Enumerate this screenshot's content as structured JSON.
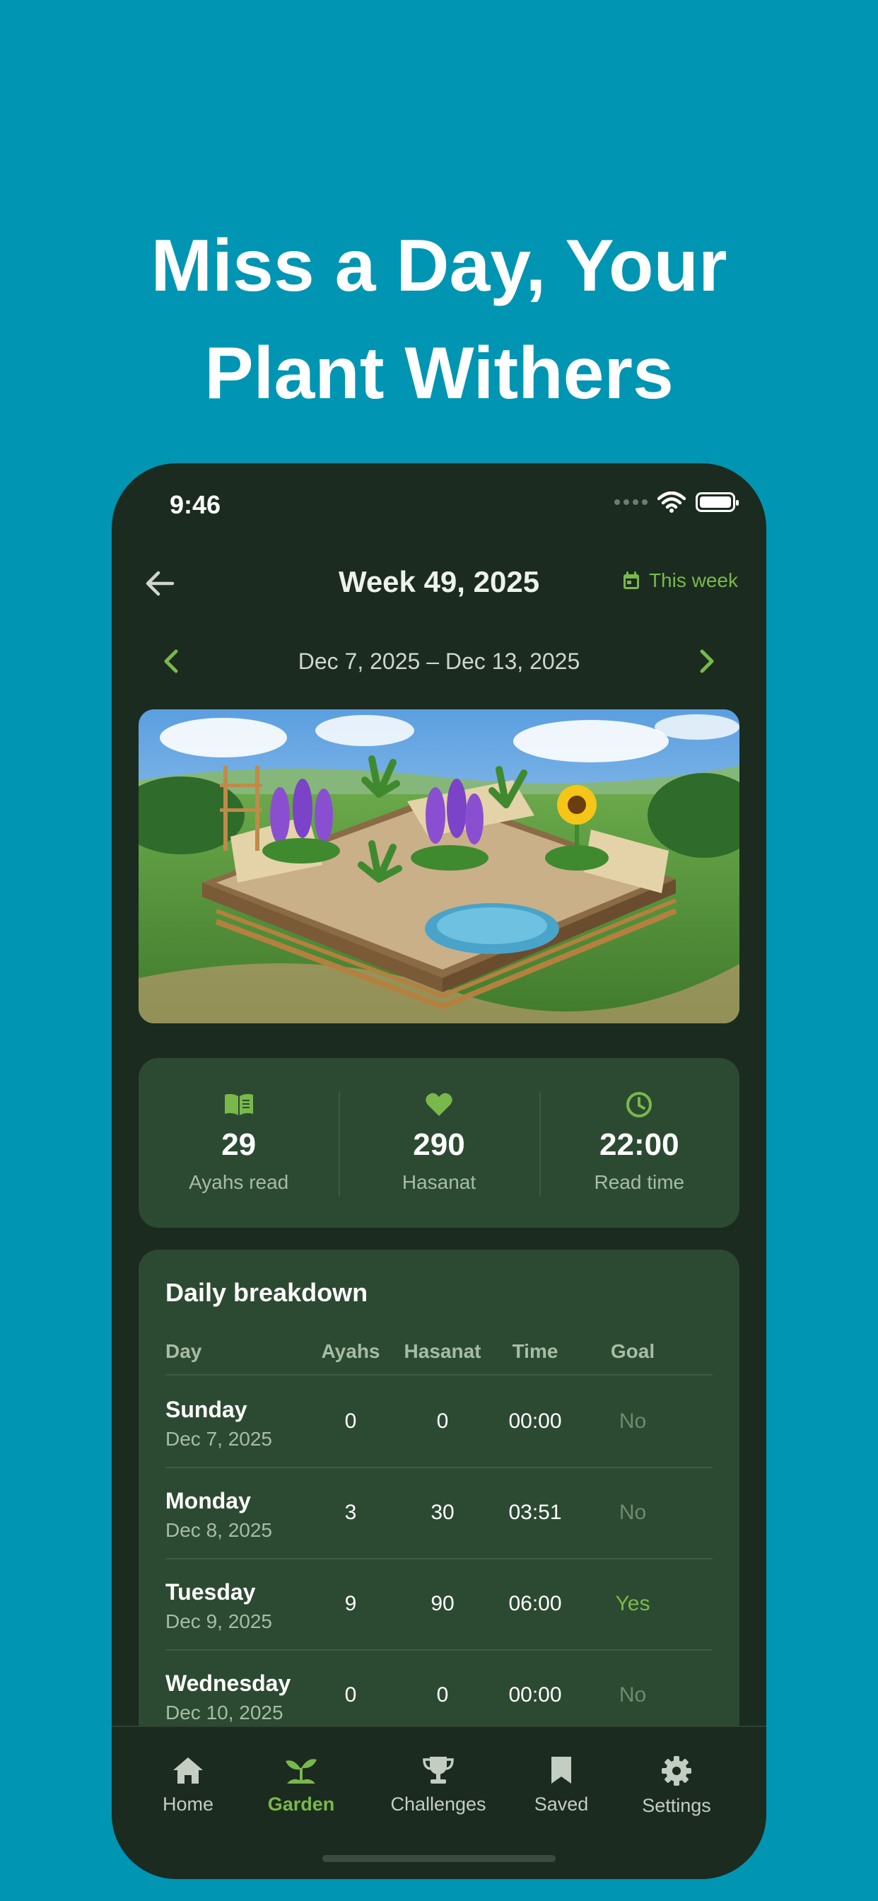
{
  "headline": {
    "line1": "Miss a Day, Your",
    "line2": "Plant Withers"
  },
  "status_bar": {
    "time": "9:46"
  },
  "header": {
    "title": "Week 49, 2025",
    "this_week_label": "This week"
  },
  "date_nav": {
    "range": "Dec 7, 2025 – Dec 13, 2025"
  },
  "garden_image": {
    "alt": "garden-illustration"
  },
  "stats": [
    {
      "icon": "book-icon",
      "value": "29",
      "label": "Ayahs read"
    },
    {
      "icon": "heart-icon",
      "value": "290",
      "label": "Hasanat"
    },
    {
      "icon": "clock-icon",
      "value": "22:00",
      "label": "Read time"
    }
  ],
  "breakdown": {
    "title": "Daily breakdown",
    "columns": {
      "day": "Day",
      "ayahs": "Ayahs",
      "hasanat": "Hasanat",
      "time": "Time",
      "goal": "Goal"
    },
    "rows": [
      {
        "day": "Sunday",
        "date": "Dec 7, 2025",
        "ayahs": "0",
        "hasanat": "0",
        "time": "00:00",
        "goal": "No"
      },
      {
        "day": "Monday",
        "date": "Dec 8, 2025",
        "ayahs": "3",
        "hasanat": "30",
        "time": "03:51",
        "goal": "No"
      },
      {
        "day": "Tuesday",
        "date": "Dec 9, 2025",
        "ayahs": "9",
        "hasanat": "90",
        "time": "06:00",
        "goal": "Yes"
      },
      {
        "day": "Wednesday",
        "date": "Dec 10, 2025",
        "ayahs": "0",
        "hasanat": "0",
        "time": "00:00",
        "goal": "No"
      }
    ]
  },
  "tabbar": [
    {
      "label": "Home",
      "icon": "home-icon",
      "active": false
    },
    {
      "label": "Garden",
      "icon": "sprout-icon",
      "active": true
    },
    {
      "label": "Challenges",
      "icon": "trophy-icon",
      "active": false
    },
    {
      "label": "Saved",
      "icon": "bookmark-icon",
      "active": false
    },
    {
      "label": "Settings",
      "icon": "gear-icon",
      "active": false
    }
  ],
  "colors": {
    "background": "#0095b2",
    "phone_bg": "#1b2b1f",
    "card_bg": "#2c4a32",
    "accent": "#79b84a"
  }
}
